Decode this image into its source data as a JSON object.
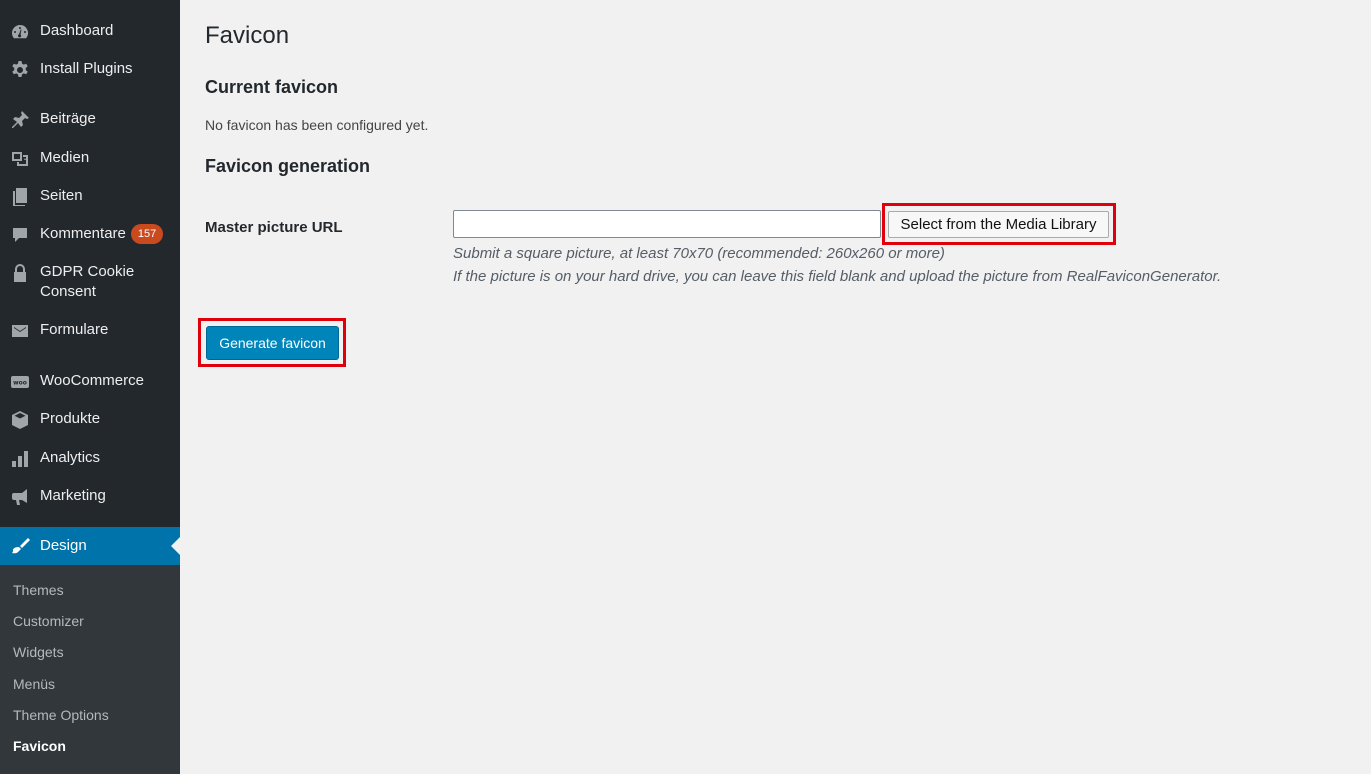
{
  "sidebar": {
    "items": [
      {
        "label": "Dashboard",
        "icon": "dashboard-icon"
      },
      {
        "label": "Install Plugins",
        "icon": "gear-icon"
      },
      {
        "label": "Beiträge",
        "icon": "pin-icon"
      },
      {
        "label": "Medien",
        "icon": "media-icon"
      },
      {
        "label": "Seiten",
        "icon": "pages-icon"
      },
      {
        "label": "Kommentare",
        "icon": "comment-icon",
        "badge": "157"
      },
      {
        "label": "GDPR Cookie Consent",
        "icon": "lock-icon"
      },
      {
        "label": "Formulare",
        "icon": "mail-icon"
      },
      {
        "label": "WooCommerce",
        "icon": "woo-icon"
      },
      {
        "label": "Produkte",
        "icon": "box-icon"
      },
      {
        "label": "Analytics",
        "icon": "bar-chart-icon"
      },
      {
        "label": "Marketing",
        "icon": "megaphone-icon"
      },
      {
        "label": "Design",
        "icon": "brush-icon",
        "active": true
      }
    ],
    "submenu": [
      {
        "label": "Themes"
      },
      {
        "label": "Customizer"
      },
      {
        "label": "Widgets"
      },
      {
        "label": "Menüs"
      },
      {
        "label": "Theme Options"
      },
      {
        "label": "Favicon",
        "current": true
      }
    ]
  },
  "main": {
    "title": "Favicon",
    "current_heading": "Current favicon",
    "current_text": "No favicon has been configured yet.",
    "generation_heading": "Favicon generation",
    "field_label": "Master picture URL",
    "url_value": "",
    "media_button": "Select from the Media Library",
    "hint1": "Submit a square picture, at least 70x70 (recommended: 260x260 or more)",
    "hint2": "If the picture is on your hard drive, you can leave this field blank and upload the picture from RealFaviconGenerator.",
    "generate_button": "Generate favicon"
  },
  "colors": {
    "sidebar_bg": "#23282d",
    "submenu_bg": "#32373c",
    "accent": "#0073aa",
    "badge": "#ca4a1f",
    "highlight": "#e0000b"
  }
}
